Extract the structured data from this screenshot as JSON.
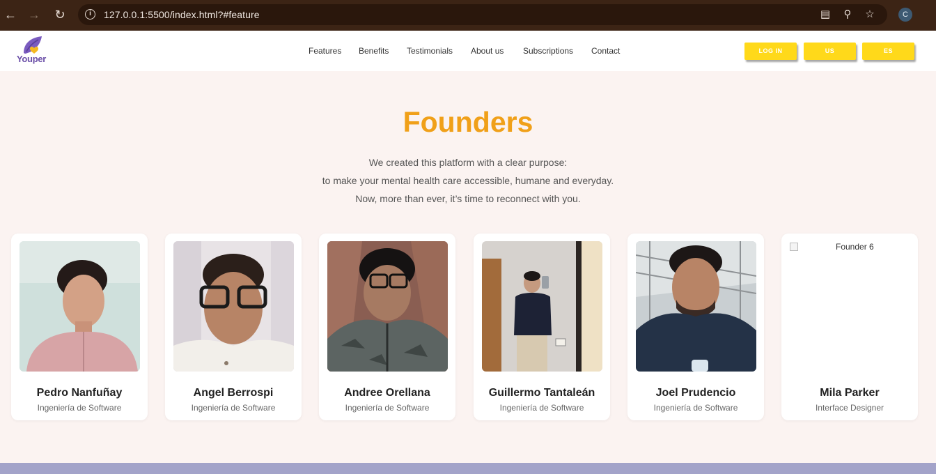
{
  "browser": {
    "url": "127.0.0.1:5500/index.html?#feature",
    "profile_initial": "C",
    "colors": {
      "frame": "#3c2415",
      "omnibox": "#2a170c"
    }
  },
  "header": {
    "logo_text": "Youper",
    "menu": [
      "Features",
      "Benefits",
      "Testimonials",
      "About us",
      "Subscriptions",
      "Contact"
    ],
    "buttons": {
      "login": "LOG IN",
      "us": "US",
      "es": "ES"
    },
    "colors": {
      "button": "#ffd91a",
      "logo_purple": "#6b4fa8",
      "logo_yellow": "#f5b921"
    }
  },
  "hero": {
    "title": "Founders",
    "subtitle_lines": [
      "We created this platform with a clear purpose:",
      "to make your mental health care accessible, humane and everyday.",
      "Now, more than ever, it’s time to reconnect with you."
    ],
    "colors": {
      "title": "#f0a019",
      "background": "#fbf3f1"
    }
  },
  "founders": [
    {
      "name": "Pedro Nanfuñay",
      "role": "Ingeniería de Software",
      "photo": "portrait-pink-shirt"
    },
    {
      "name": "Angel Berrospi",
      "role": "Ingeniería de Software",
      "photo": "portrait-glasses-white-shirt"
    },
    {
      "name": "Andree Orellana",
      "role": "Ingeniería de Software",
      "photo": "portrait-glasses-camo-hoodie"
    },
    {
      "name": "Guillermo Tantaleán",
      "role": "Ingeniería de Software",
      "photo": "mirror-selfie"
    },
    {
      "name": "Joel Prudencio",
      "role": "Ingeniería de Software",
      "photo": "portrait-navy-tshirt"
    },
    {
      "name": "Mila Parker",
      "role": "Interface Designer",
      "photo_alt": "Founder 6"
    }
  ]
}
